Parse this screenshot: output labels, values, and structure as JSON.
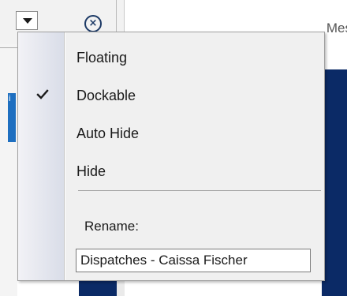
{
  "header": {
    "tab_text": "Mes",
    "side_tab_text": "i"
  },
  "menu": {
    "items": [
      {
        "label": "Floating",
        "checked": false
      },
      {
        "label": "Dockable",
        "checked": true
      },
      {
        "label": "Auto Hide",
        "checked": false
      },
      {
        "label": "Hide",
        "checked": false
      }
    ],
    "rename_label": "Rename:",
    "rename_value": "Dispatches - Caissa Fischer"
  },
  "icons": {
    "dropdown": "chevron-down-icon",
    "close": "close-circle-icon",
    "check": "checkmark-icon"
  },
  "colors": {
    "navy": "#0b2a66",
    "accent_blue": "#1e6fc0",
    "menu_bg": "#f0f0f0"
  }
}
